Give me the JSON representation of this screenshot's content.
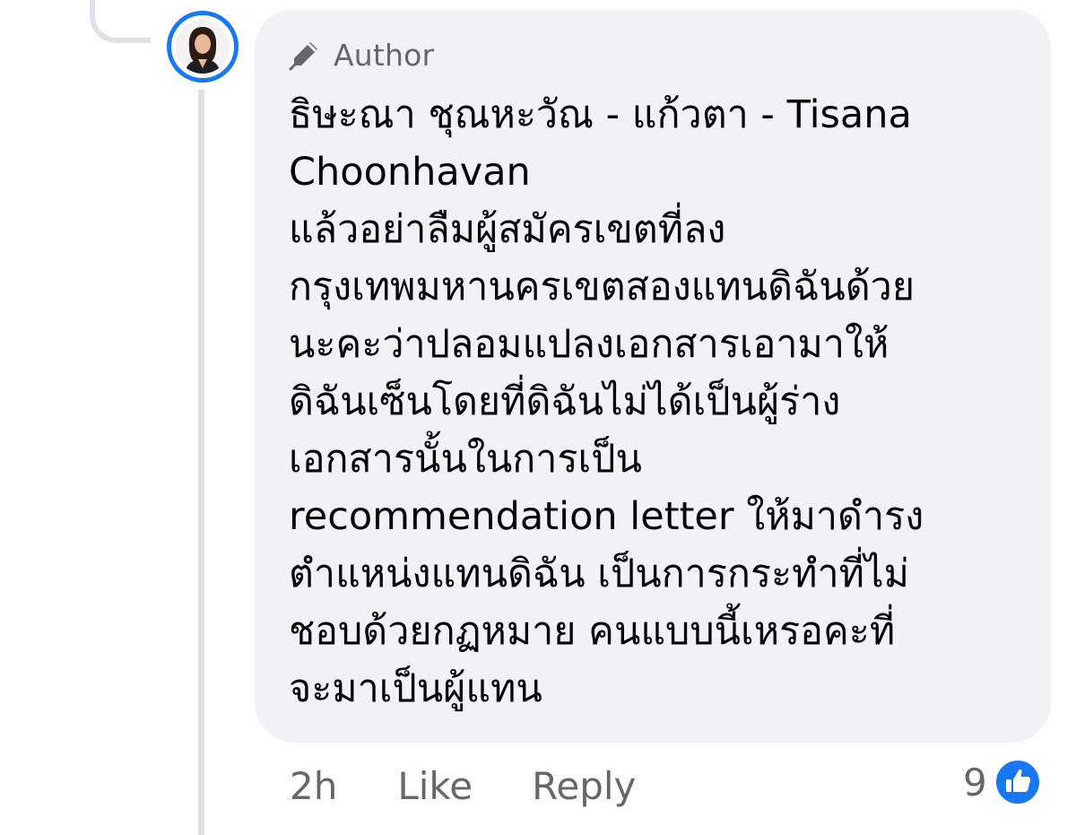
{
  "comment": {
    "badge": {
      "icon": "pencil-icon",
      "label": "Author"
    },
    "lines": [
      "ธิษะณา ชุณหะวัณ - แก้วตา - Tisana",
      "Choonhavan",
      "แล้วอย่าลืมผู้สมัครเขตที่ลง",
      "กรุงเทพมหานครเขตสองแทนดิฉันด้วย",
      "นะคะว่าปลอมแปลงเอกสารเอามาให้",
      "ดิฉันเซ็นโดยที่ดิฉันไม่ได้เป็นผู้ร่าง",
      "เอกสารนั้นในการเป็น",
      "recommendation letter ให้มาดำรง",
      "ตำแหน่งแทนดิฉัน เป็นการกระทำที่ไม่",
      "ชอบด้วยกฏหมาย คนแบบนี้เหรอคะที่",
      "จะมาเป็นผู้แทน"
    ]
  },
  "footer": {
    "time": "2h",
    "like_label": "Like",
    "reply_label": "Reply",
    "reaction_count": "9",
    "reaction_icon": "like-icon"
  },
  "colors": {
    "bubble_bg": "#f0f2f5",
    "accent_blue": "#1877f2",
    "muted_text": "#65676b",
    "thread_line": "#dfe1e6"
  }
}
